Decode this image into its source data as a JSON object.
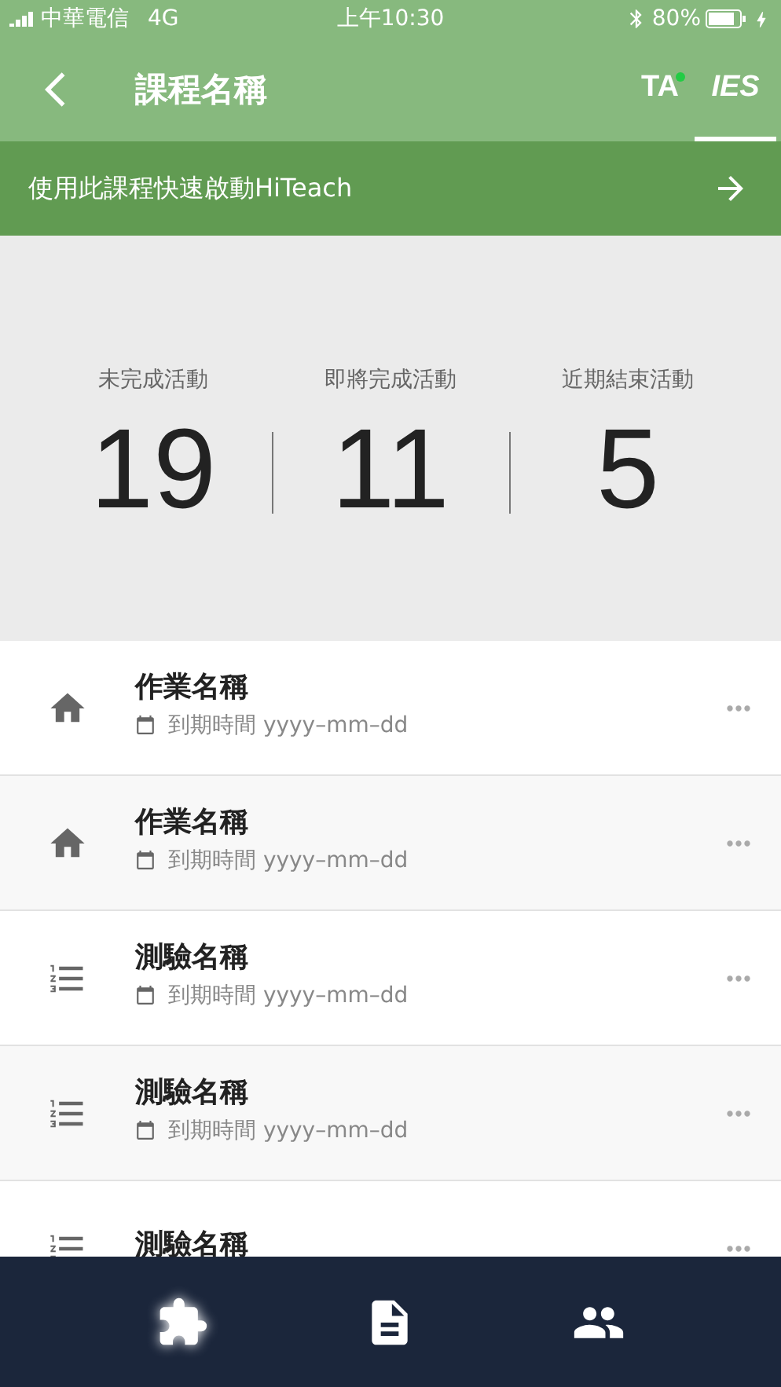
{
  "status_bar": {
    "carrier": "中華電信",
    "network": "4G",
    "time": "上午10:30",
    "battery": "80%"
  },
  "header": {
    "title": "課程名稱",
    "tabs": [
      {
        "label": "TA",
        "selected": false,
        "has_dot": true
      },
      {
        "label": "IES",
        "selected": true
      }
    ]
  },
  "banner": {
    "text": "使用此課程快速啟動HiTeach"
  },
  "stats": [
    {
      "label": "未完成活動",
      "value": "19"
    },
    {
      "label": "即將完成活動",
      "value": "11"
    },
    {
      "label": "近期結束活動",
      "value": "5"
    }
  ],
  "items": [
    {
      "kind": "homework",
      "title": "作業名稱",
      "due": "到期時間 yyyy–mm–dd"
    },
    {
      "kind": "homework",
      "title": "作業名稱",
      "due": "到期時間 yyyy–mm–dd"
    },
    {
      "kind": "quiz",
      "title": "測驗名稱",
      "due": "到期時間 yyyy–mm–dd"
    },
    {
      "kind": "quiz",
      "title": "測驗名稱",
      "due": "到期時間 yyyy–mm–dd"
    },
    {
      "kind": "quiz",
      "title": "測驗名稱"
    }
  ],
  "bottom_nav": [
    {
      "kind": "activities",
      "selected": true
    },
    {
      "kind": "documents",
      "selected": false
    },
    {
      "kind": "members",
      "selected": false
    }
  ]
}
